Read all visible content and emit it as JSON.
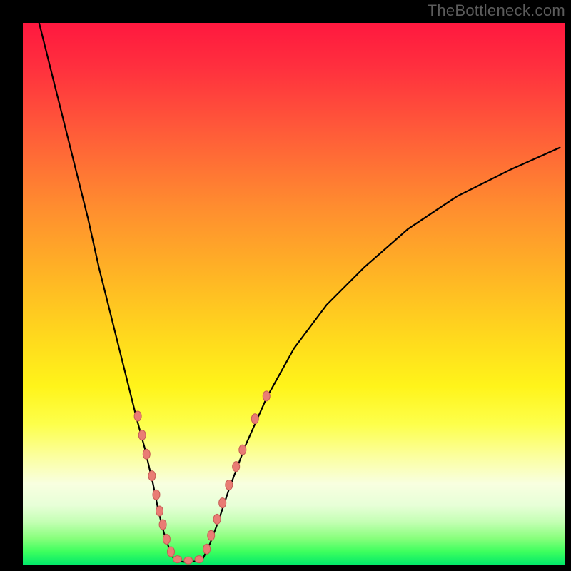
{
  "watermark": "TheBottleneck.com",
  "chart_data": {
    "type": "line",
    "title": "",
    "xlabel": "",
    "ylabel": "",
    "xlim": [
      0,
      100
    ],
    "ylim": [
      0,
      100
    ],
    "grid": false,
    "series": [
      {
        "name": "left-arm",
        "x": [
          3,
          6,
          9,
          12,
          14,
          16,
          18,
          19.5,
          21,
          22.5,
          24,
          25,
          26,
          27,
          28
        ],
        "y": [
          100,
          88,
          76,
          64,
          55,
          47,
          39,
          33,
          27,
          21.5,
          15,
          10,
          6,
          3,
          0.8
        ]
      },
      {
        "name": "floor",
        "x": [
          28,
          30,
          33
        ],
        "y": [
          0.8,
          0.6,
          0.8
        ]
      },
      {
        "name": "right-arm",
        "x": [
          33,
          34.5,
          36,
          38,
          41,
          45,
          50,
          56,
          63,
          71,
          80,
          90,
          99
        ],
        "y": [
          0.8,
          4,
          8,
          14,
          22,
          31,
          40,
          48,
          55,
          62,
          68,
          73,
          77
        ]
      }
    ],
    "markers": {
      "name": "highlighted-points",
      "color": "#e97c74",
      "points": [
        {
          "x": 21.2,
          "y": 27.5,
          "rx": 5,
          "ry": 7
        },
        {
          "x": 22.0,
          "y": 24.0,
          "rx": 5,
          "ry": 7
        },
        {
          "x": 22.8,
          "y": 20.5,
          "rx": 5,
          "ry": 7
        },
        {
          "x": 23.8,
          "y": 16.5,
          "rx": 5,
          "ry": 7
        },
        {
          "x": 24.6,
          "y": 13.0,
          "rx": 5,
          "ry": 7
        },
        {
          "x": 25.2,
          "y": 10.0,
          "rx": 5,
          "ry": 7
        },
        {
          "x": 25.8,
          "y": 7.5,
          "rx": 5,
          "ry": 7
        },
        {
          "x": 26.5,
          "y": 4.8,
          "rx": 5,
          "ry": 7
        },
        {
          "x": 27.3,
          "y": 2.5,
          "rx": 5,
          "ry": 7
        },
        {
          "x": 28.5,
          "y": 1.1,
          "rx": 6,
          "ry": 5
        },
        {
          "x": 30.5,
          "y": 0.9,
          "rx": 6,
          "ry": 5
        },
        {
          "x": 32.5,
          "y": 1.1,
          "rx": 6,
          "ry": 5
        },
        {
          "x": 33.9,
          "y": 3.0,
          "rx": 5,
          "ry": 7
        },
        {
          "x": 34.7,
          "y": 5.5,
          "rx": 5,
          "ry": 7
        },
        {
          "x": 35.8,
          "y": 8.5,
          "rx": 5,
          "ry": 7
        },
        {
          "x": 36.8,
          "y": 11.5,
          "rx": 5,
          "ry": 7
        },
        {
          "x": 38.0,
          "y": 14.8,
          "rx": 5,
          "ry": 7
        },
        {
          "x": 39.3,
          "y": 18.2,
          "rx": 5,
          "ry": 7
        },
        {
          "x": 40.5,
          "y": 21.3,
          "rx": 5,
          "ry": 7
        },
        {
          "x": 42.8,
          "y": 27.0,
          "rx": 5,
          "ry": 7
        },
        {
          "x": 44.9,
          "y": 31.2,
          "rx": 5,
          "ry": 7
        }
      ]
    }
  }
}
